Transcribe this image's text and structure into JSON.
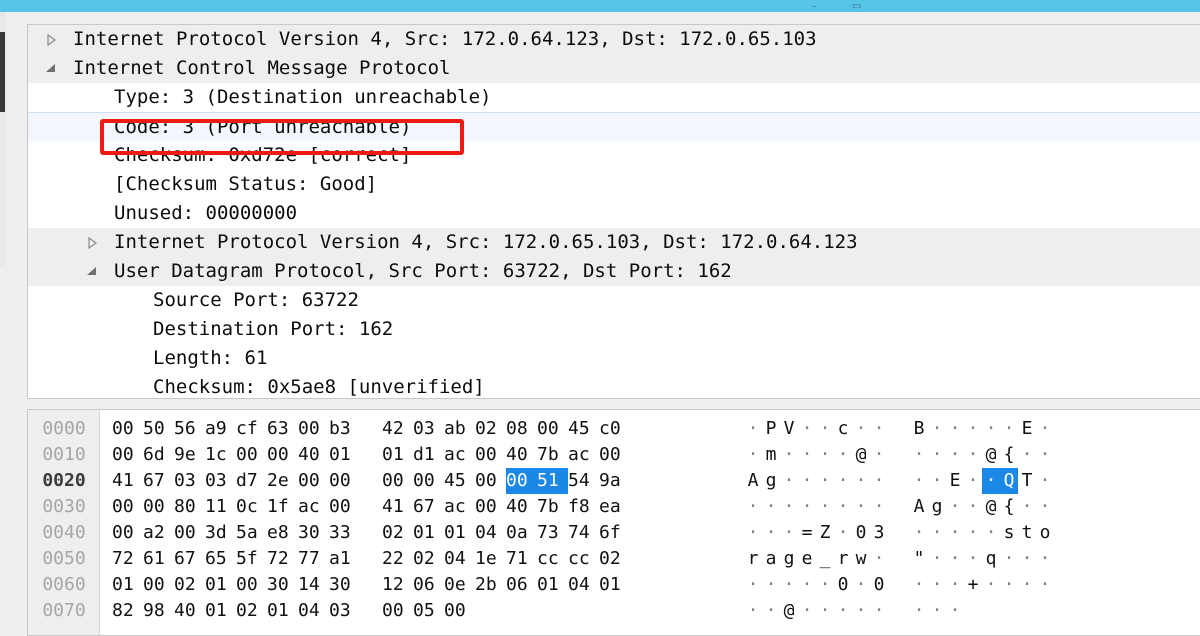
{
  "window": {
    "titlebar_color": "#56c5e8",
    "minimize_glyph": "–",
    "restore_glyph": "▭"
  },
  "annotation": {
    "color": "#ee1b13",
    "target_row_label": "Code: 3 (Port unreachable)"
  },
  "detail_tree": {
    "rows": [
      {
        "indent": "lvl1",
        "twisty": "collapsed",
        "shaded": true,
        "selected": false,
        "label": "Internet Protocol Version 4, Src: 172.0.64.123, Dst: 172.0.65.103"
      },
      {
        "indent": "lvl1",
        "twisty": "expanded",
        "shaded": true,
        "selected": false,
        "label": "Internet Control Message Protocol"
      },
      {
        "indent": "lvl2f",
        "twisty": "none",
        "shaded": false,
        "selected": false,
        "label": "Type: 3 (Destination unreachable)"
      },
      {
        "indent": "lvl2f",
        "twisty": "none",
        "shaded": false,
        "selected": true,
        "label": "Code: 3 (Port unreachable)"
      },
      {
        "indent": "lvl2f",
        "twisty": "none",
        "shaded": false,
        "selected": false,
        "label": "Checksum: 0xd72e [correct]"
      },
      {
        "indent": "lvl2f",
        "twisty": "none",
        "shaded": false,
        "selected": false,
        "label": "[Checksum Status: Good]"
      },
      {
        "indent": "lvl2f",
        "twisty": "none",
        "shaded": false,
        "selected": false,
        "label": "Unused: 00000000"
      },
      {
        "indent": "lvl2",
        "twisty": "collapsed",
        "shaded": true,
        "selected": false,
        "label": "Internet Protocol Version 4, Src: 172.0.65.103, Dst: 172.0.64.123"
      },
      {
        "indent": "lvl2",
        "twisty": "expanded",
        "shaded": true,
        "selected": false,
        "label": "User Datagram Protocol, Src Port: 63722, Dst Port: 162"
      },
      {
        "indent": "lvl3f",
        "twisty": "none",
        "shaded": false,
        "selected": false,
        "label": "Source Port: 63722"
      },
      {
        "indent": "lvl3f",
        "twisty": "none",
        "shaded": false,
        "selected": false,
        "label": "Destination Port: 162"
      },
      {
        "indent": "lvl3f",
        "twisty": "none",
        "shaded": false,
        "selected": false,
        "label": "Length: 61"
      },
      {
        "indent": "lvl3f",
        "twisty": "none",
        "shaded": false,
        "selected": false,
        "label": "Checksum: 0x5ae8 [unverified]"
      }
    ]
  },
  "hex_dump": {
    "selection_color": "#1b87e6",
    "rows": [
      {
        "offset": "0000",
        "active": false,
        "bytes": [
          "00",
          "50",
          "56",
          "a9",
          "cf",
          "63",
          "00",
          "b3",
          "42",
          "03",
          "ab",
          "02",
          "08",
          "00",
          "45",
          "c0"
        ],
        "selected_bytes": [],
        "ascii": [
          ".",
          "P",
          "V",
          ".",
          ".",
          "c",
          ".",
          ".",
          "B",
          ".",
          ".",
          ".",
          ".",
          ".",
          "E",
          "."
        ],
        "selected_ascii": []
      },
      {
        "offset": "0010",
        "active": false,
        "bytes": [
          "00",
          "6d",
          "9e",
          "1c",
          "00",
          "00",
          "40",
          "01",
          "01",
          "d1",
          "ac",
          "00",
          "40",
          "7b",
          "ac",
          "00"
        ],
        "selected_bytes": [],
        "ascii": [
          ".",
          "m",
          ".",
          ".",
          ".",
          ".",
          "@",
          ".",
          ".",
          ".",
          ".",
          ".",
          "@",
          "{",
          ".",
          "."
        ],
        "selected_ascii": []
      },
      {
        "offset": "0020",
        "active": true,
        "bytes": [
          "41",
          "67",
          "03",
          "03",
          "d7",
          "2e",
          "00",
          "00",
          "00",
          "00",
          "45",
          "00",
          "00",
          "51",
          "54",
          "9a"
        ],
        "selected_bytes": [
          12,
          13
        ],
        "ascii": [
          "A",
          "g",
          ".",
          ".",
          ".",
          ".",
          ".",
          ".",
          ".",
          ".",
          "E",
          ".",
          ".",
          "Q",
          "T",
          "."
        ],
        "selected_ascii": [
          12,
          13
        ]
      },
      {
        "offset": "0030",
        "active": false,
        "bytes": [
          "00",
          "00",
          "80",
          "11",
          "0c",
          "1f",
          "ac",
          "00",
          "41",
          "67",
          "ac",
          "00",
          "40",
          "7b",
          "f8",
          "ea"
        ],
        "selected_bytes": [],
        "ascii": [
          ".",
          ".",
          ".",
          ".",
          ".",
          ".",
          ".",
          ".",
          "A",
          "g",
          ".",
          ".",
          "@",
          "{",
          ".",
          "."
        ],
        "selected_ascii": []
      },
      {
        "offset": "0040",
        "active": false,
        "bytes": [
          "00",
          "a2",
          "00",
          "3d",
          "5a",
          "e8",
          "30",
          "33",
          "02",
          "01",
          "01",
          "04",
          "0a",
          "73",
          "74",
          "6f"
        ],
        "selected_bytes": [],
        "ascii": [
          ".",
          ".",
          ".",
          "=",
          "Z",
          ".",
          "0",
          "3",
          ".",
          ".",
          ".",
          ".",
          ".",
          "s",
          "t",
          "o"
        ],
        "selected_ascii": []
      },
      {
        "offset": "0050",
        "active": false,
        "bytes": [
          "72",
          "61",
          "67",
          "65",
          "5f",
          "72",
          "77",
          "a1",
          "22",
          "02",
          "04",
          "1e",
          "71",
          "cc",
          "cc",
          "02"
        ],
        "selected_bytes": [],
        "ascii": [
          "r",
          "a",
          "g",
          "e",
          "_",
          "r",
          "w",
          ".",
          "\"",
          ".",
          ".",
          ".",
          "q",
          ".",
          ".",
          "."
        ],
        "selected_ascii": []
      },
      {
        "offset": "0060",
        "active": false,
        "bytes": [
          "01",
          "00",
          "02",
          "01",
          "00",
          "30",
          "14",
          "30",
          "12",
          "06",
          "0e",
          "2b",
          "06",
          "01",
          "04",
          "01"
        ],
        "selected_bytes": [],
        "ascii": [
          ".",
          ".",
          ".",
          ".",
          ".",
          "0",
          ".",
          "0",
          ".",
          ".",
          ".",
          "+",
          ".",
          ".",
          ".",
          "."
        ],
        "selected_ascii": []
      },
      {
        "offset": "0070",
        "active": false,
        "bytes": [
          "82",
          "98",
          "40",
          "01",
          "02",
          "01",
          "04",
          "03",
          "00",
          "05",
          "00"
        ],
        "selected_bytes": [],
        "ascii": [
          ".",
          ".",
          "@",
          ".",
          ".",
          ".",
          ".",
          ".",
          ".",
          ".",
          "."
        ],
        "selected_ascii": []
      }
    ]
  }
}
